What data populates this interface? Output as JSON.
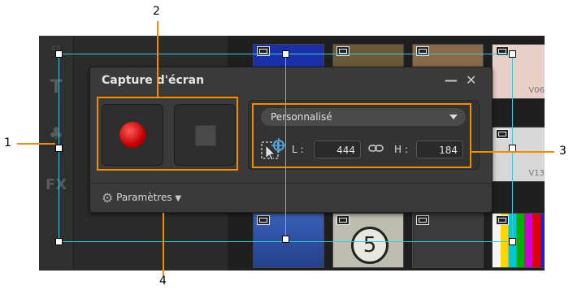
{
  "panel": {
    "title": "Capture d'écran",
    "minimize_glyph": "—",
    "close_glyph": "✕"
  },
  "region": {
    "preset": "Personnalisé",
    "width_label": "L :",
    "width_value": "444",
    "height_label": "H :",
    "height_value": "184"
  },
  "settings": {
    "label": "Paramètres"
  },
  "sidebar": {
    "items": [
      "T",
      "FX"
    ]
  },
  "thumbnails": {
    "labels": [
      "V06",
      "V13"
    ],
    "countdown": "5"
  },
  "callouts": [
    "1",
    "2",
    "3",
    "4"
  ],
  "colors": {
    "callout_frame": "#f28c00",
    "capture_region": "#3ec7d6",
    "record": "#d40000"
  },
  "icons": [
    "record-icon",
    "stop-icon",
    "dropdown-arrow-icon",
    "region-target-icon",
    "link-icon",
    "gear-icon",
    "film-icon"
  ]
}
